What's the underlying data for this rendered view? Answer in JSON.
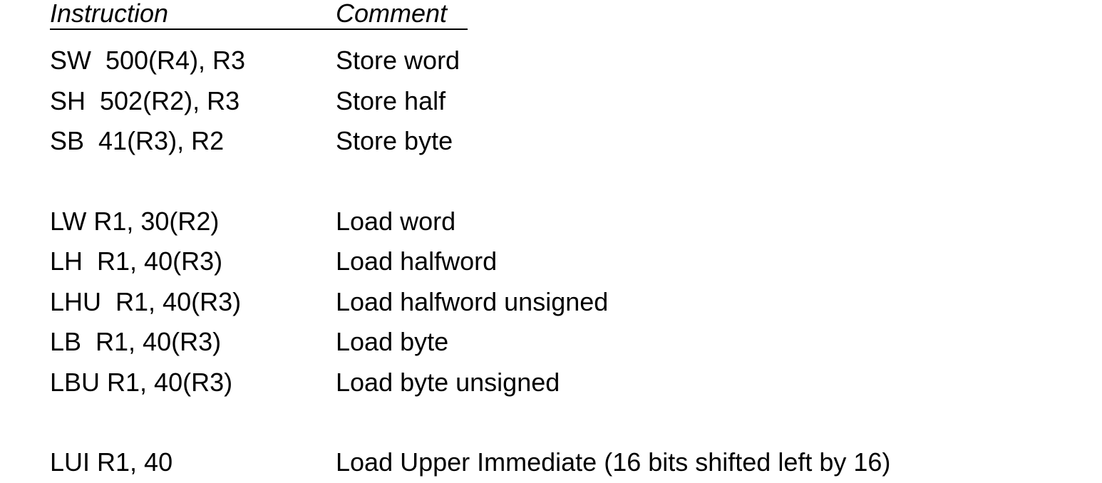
{
  "header": {
    "instruction": "Instruction",
    "comment": "Comment"
  },
  "groups": [
    {
      "rows": [
        {
          "instruction": "SW  500(R4), R3",
          "comment": "Store word"
        },
        {
          "instruction": "SH  502(R2), R3",
          "comment": "Store half"
        },
        {
          "instruction": "SB  41(R3), R2",
          "comment": "Store byte"
        }
      ]
    },
    {
      "rows": [
        {
          "instruction": "LW R1, 30(R2)",
          "comment": "Load word"
        },
        {
          "instruction": "LH  R1, 40(R3)",
          "comment": "Load halfword"
        },
        {
          "instruction": "LHU  R1, 40(R3)",
          "comment": "Load halfword unsigned"
        },
        {
          "instruction": "LB  R1, 40(R3)",
          "comment": "Load byte"
        },
        {
          "instruction": "LBU R1, 40(R3)",
          "comment": "Load byte unsigned"
        }
      ]
    },
    {
      "rows": [
        {
          "instruction": "LUI R1, 40",
          "comment": "Load Upper Immediate (16 bits shifted left by 16)"
        }
      ]
    }
  ]
}
